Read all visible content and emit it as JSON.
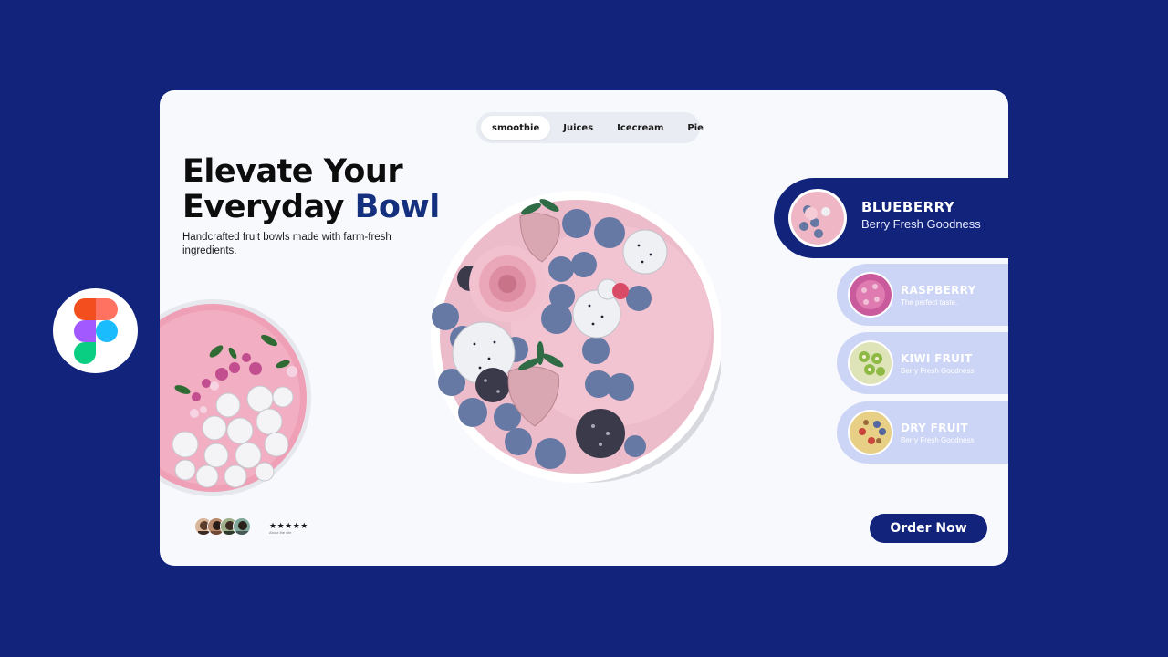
{
  "brand": {
    "badge_icon": "figma-logo-icon"
  },
  "colors": {
    "background": "#12237c",
    "accent": "#15307f",
    "card": "#f7f9fd",
    "option_bg": "#ccd5f6"
  },
  "tabs": [
    {
      "label": "smoothie",
      "active": true
    },
    {
      "label": "Juices",
      "active": false
    },
    {
      "label": "Icecream",
      "active": false
    },
    {
      "label": "Pie",
      "active": false
    }
  ],
  "hero": {
    "headline_line1": "Elevate Your",
    "headline_line2_prefix": "Everyday",
    "headline_accent": "Bowl",
    "subtext": "Handcrafted fruit bowls made with farm-fresh ingredients."
  },
  "featured": {
    "title": "BLUEBERRY",
    "subtitle": "Berry Fresh Goodness"
  },
  "options": [
    {
      "title": "RASPBERRY",
      "subtitle": "The perfect taste."
    },
    {
      "title": "KIWI FRUIT",
      "subtitle": "Berry Fresh Goodness"
    },
    {
      "title": "DRY FRUIT",
      "subtitle": "Berry Fresh Goodness"
    }
  ],
  "reviews": {
    "stars": "★★★★★",
    "note": "About the site"
  },
  "cta": {
    "label": "Order Now"
  }
}
